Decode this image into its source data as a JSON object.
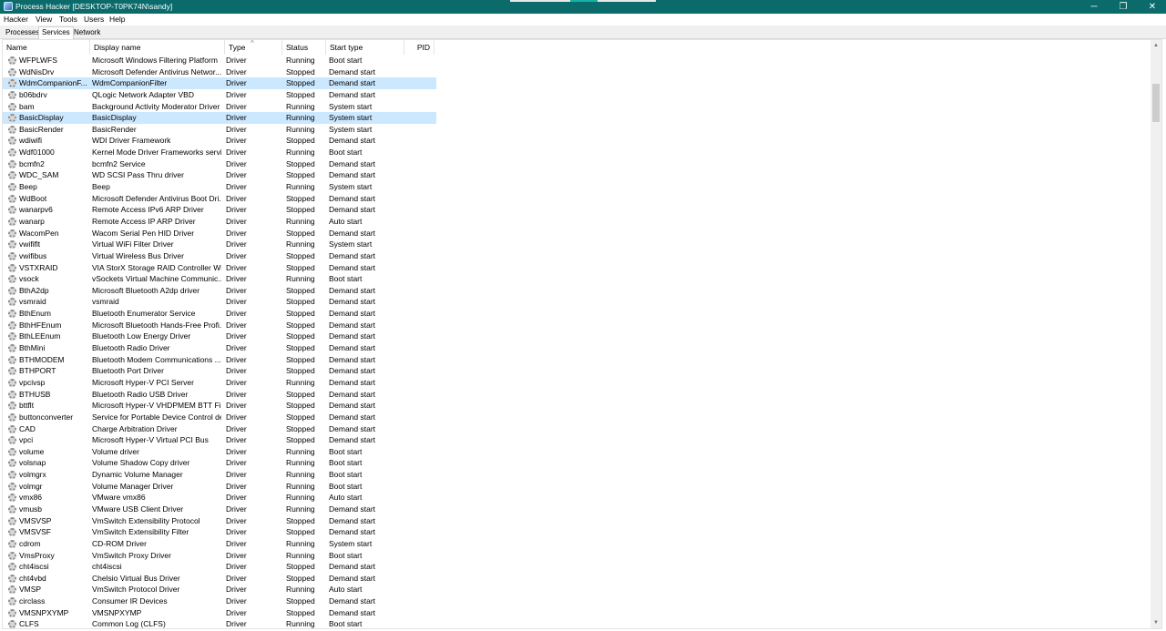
{
  "window": {
    "title": "Process Hacker [DESKTOP-T0PK74N\\sandy]",
    "minimize_glyph": "─",
    "maximize_glyph": "❐",
    "close_glyph": "✕",
    "title_bar_color": "#0b6b6b"
  },
  "menu": [
    "Hacker",
    "View",
    "Tools",
    "Users",
    "Help"
  ],
  "tabs": [
    "Processes",
    "Services",
    "Network"
  ],
  "active_tab": "Services",
  "columns": [
    "Name",
    "Display name",
    "Type",
    "Status",
    "Start type",
    "PID"
  ],
  "icons": {
    "service": "gear-icon",
    "app": "process-hacker-icon"
  },
  "rows": [
    {
      "name": "WFPLWFS",
      "display": "Microsoft Windows Filtering Platform",
      "type": "Driver",
      "status": "Running",
      "start": "Boot start"
    },
    {
      "name": "WdNisDrv",
      "display": "Microsoft Defender Antivirus Networ...",
      "type": "Driver",
      "status": "Stopped",
      "start": "Demand start"
    },
    {
      "name": "WdmCompanionF...",
      "display": "WdmCompanionFilter",
      "type": "Driver",
      "status": "Stopped",
      "start": "Demand start",
      "selected": true
    },
    {
      "name": "b06bdrv",
      "display": "QLogic Network Adapter VBD",
      "type": "Driver",
      "status": "Stopped",
      "start": "Demand start"
    },
    {
      "name": "bam",
      "display": "Background Activity Moderator Driver",
      "type": "Driver",
      "status": "Running",
      "start": "System start"
    },
    {
      "name": "BasicDisplay",
      "display": "BasicDisplay",
      "type": "Driver",
      "status": "Running",
      "start": "System start",
      "selected": true
    },
    {
      "name": "BasicRender",
      "display": "BasicRender",
      "type": "Driver",
      "status": "Running",
      "start": "System start"
    },
    {
      "name": "wdiwifi",
      "display": "WDI Driver Framework",
      "type": "Driver",
      "status": "Stopped",
      "start": "Demand start"
    },
    {
      "name": "Wdf01000",
      "display": "Kernel Mode Driver Frameworks service",
      "type": "Driver",
      "status": "Running",
      "start": "Boot start"
    },
    {
      "name": "bcmfn2",
      "display": "bcmfn2 Service",
      "type": "Driver",
      "status": "Stopped",
      "start": "Demand start"
    },
    {
      "name": "WDC_SAM",
      "display": "WD SCSI Pass Thru driver",
      "type": "Driver",
      "status": "Stopped",
      "start": "Demand start"
    },
    {
      "name": "Beep",
      "display": "Beep",
      "type": "Driver",
      "status": "Running",
      "start": "System start"
    },
    {
      "name": "WdBoot",
      "display": "Microsoft Defender Antivirus Boot Dri...",
      "type": "Driver",
      "status": "Stopped",
      "start": "Demand start"
    },
    {
      "name": "wanarpv6",
      "display": "Remote Access IPv6 ARP Driver",
      "type": "Driver",
      "status": "Stopped",
      "start": "Demand start"
    },
    {
      "name": "wanarp",
      "display": "Remote Access IP ARP Driver",
      "type": "Driver",
      "status": "Running",
      "start": "Auto start"
    },
    {
      "name": "WacomPen",
      "display": "Wacom Serial Pen HID Driver",
      "type": "Driver",
      "status": "Stopped",
      "start": "Demand start"
    },
    {
      "name": "vwififlt",
      "display": "Virtual WiFi Filter Driver",
      "type": "Driver",
      "status": "Running",
      "start": "System start"
    },
    {
      "name": "vwifibus",
      "display": "Virtual Wireless Bus Driver",
      "type": "Driver",
      "status": "Stopped",
      "start": "Demand start"
    },
    {
      "name": "VSTXRAID",
      "display": "VIA StorX Storage RAID Controller Wi...",
      "type": "Driver",
      "status": "Stopped",
      "start": "Demand start"
    },
    {
      "name": "vsock",
      "display": "vSockets Virtual Machine Communic...",
      "type": "Driver",
      "status": "Running",
      "start": "Boot start"
    },
    {
      "name": "BthA2dp",
      "display": "Microsoft Bluetooth A2dp driver",
      "type": "Driver",
      "status": "Stopped",
      "start": "Demand start"
    },
    {
      "name": "vsmraid",
      "display": "vsmraid",
      "type": "Driver",
      "status": "Stopped",
      "start": "Demand start"
    },
    {
      "name": "BthEnum",
      "display": "Bluetooth Enumerator Service",
      "type": "Driver",
      "status": "Stopped",
      "start": "Demand start"
    },
    {
      "name": "BthHFEnum",
      "display": "Microsoft Bluetooth Hands-Free Profi...",
      "type": "Driver",
      "status": "Stopped",
      "start": "Demand start"
    },
    {
      "name": "BthLEEnum",
      "display": "Bluetooth Low Energy Driver",
      "type": "Driver",
      "status": "Stopped",
      "start": "Demand start"
    },
    {
      "name": "BthMini",
      "display": "Bluetooth Radio Driver",
      "type": "Driver",
      "status": "Stopped",
      "start": "Demand start"
    },
    {
      "name": "BTHMODEM",
      "display": "Bluetooth Modem Communications ...",
      "type": "Driver",
      "status": "Stopped",
      "start": "Demand start"
    },
    {
      "name": "BTHPORT",
      "display": "Bluetooth Port Driver",
      "type": "Driver",
      "status": "Stopped",
      "start": "Demand start"
    },
    {
      "name": "vpcivsp",
      "display": "Microsoft Hyper-V PCI Server",
      "type": "Driver",
      "status": "Running",
      "start": "Demand start"
    },
    {
      "name": "BTHUSB",
      "display": "Bluetooth Radio USB Driver",
      "type": "Driver",
      "status": "Stopped",
      "start": "Demand start"
    },
    {
      "name": "bttflt",
      "display": "Microsoft Hyper-V VHDPMEM BTT Fil...",
      "type": "Driver",
      "status": "Stopped",
      "start": "Demand start"
    },
    {
      "name": "buttonconverter",
      "display": "Service for Portable Device Control de...",
      "type": "Driver",
      "status": "Stopped",
      "start": "Demand start"
    },
    {
      "name": "CAD",
      "display": "Charge Arbitration Driver",
      "type": "Driver",
      "status": "Stopped",
      "start": "Demand start"
    },
    {
      "name": "vpci",
      "display": "Microsoft Hyper-V Virtual PCI Bus",
      "type": "Driver",
      "status": "Stopped",
      "start": "Demand start"
    },
    {
      "name": "volume",
      "display": "Volume driver",
      "type": "Driver",
      "status": "Running",
      "start": "Boot start"
    },
    {
      "name": "volsnap",
      "display": "Volume Shadow Copy driver",
      "type": "Driver",
      "status": "Running",
      "start": "Boot start"
    },
    {
      "name": "volmgrx",
      "display": "Dynamic Volume Manager",
      "type": "Driver",
      "status": "Running",
      "start": "Boot start"
    },
    {
      "name": "volmgr",
      "display": "Volume Manager Driver",
      "type": "Driver",
      "status": "Running",
      "start": "Boot start"
    },
    {
      "name": "vmx86",
      "display": "VMware vmx86",
      "type": "Driver",
      "status": "Running",
      "start": "Auto start"
    },
    {
      "name": "vmusb",
      "display": "VMware USB Client Driver",
      "type": "Driver",
      "status": "Running",
      "start": "Demand start"
    },
    {
      "name": "VMSVSP",
      "display": "VmSwitch Extensibility Protocol",
      "type": "Driver",
      "status": "Stopped",
      "start": "Demand start"
    },
    {
      "name": "VMSVSF",
      "display": "VmSwitch Extensibility Filter",
      "type": "Driver",
      "status": "Stopped",
      "start": "Demand start"
    },
    {
      "name": "cdrom",
      "display": "CD-ROM Driver",
      "type": "Driver",
      "status": "Running",
      "start": "System start"
    },
    {
      "name": "VmsProxy",
      "display": "VmSwitch Proxy Driver",
      "type": "Driver",
      "status": "Running",
      "start": "Boot start"
    },
    {
      "name": "cht4iscsi",
      "display": "cht4iscsi",
      "type": "Driver",
      "status": "Stopped",
      "start": "Demand start"
    },
    {
      "name": "cht4vbd",
      "display": "Chelsio Virtual Bus Driver",
      "type": "Driver",
      "status": "Stopped",
      "start": "Demand start"
    },
    {
      "name": "VMSP",
      "display": "VmSwitch Protocol Driver",
      "type": "Driver",
      "status": "Running",
      "start": "Auto start"
    },
    {
      "name": "circlass",
      "display": "Consumer IR Devices",
      "type": "Driver",
      "status": "Stopped",
      "start": "Demand start"
    },
    {
      "name": "VMSNPXYMP",
      "display": "VMSNPXYMP",
      "type": "Driver",
      "status": "Stopped",
      "start": "Demand start"
    },
    {
      "name": "CLFS",
      "display": "Common Log (CLFS)",
      "type": "Driver",
      "status": "Running",
      "start": "Boot start"
    }
  ]
}
